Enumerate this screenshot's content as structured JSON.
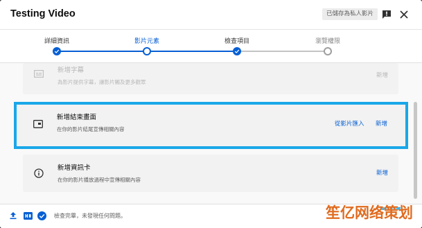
{
  "window": {
    "title": "Testing Video",
    "save_status": "已儲存為私人影片"
  },
  "icons": {
    "report": "report-flag-icon",
    "close": "close-icon"
  },
  "stepper": {
    "steps": [
      {
        "label": "詳細資訊",
        "state": "done"
      },
      {
        "label": "影片元素",
        "state": "current"
      },
      {
        "label": "檢查項目",
        "state": "done"
      },
      {
        "label": "瀏覽權限",
        "state": "future"
      }
    ]
  },
  "cards": [
    {
      "title": "新增字幕",
      "desc": "為影片提供字幕，讓影片觸及更多觀眾",
      "action": "新增",
      "secondary": "",
      "icon": "subtitles-icon"
    },
    {
      "title": "新增結束畫面",
      "desc": "在你的影片結尾宣傳相關內容",
      "action": "新增",
      "secondary": "從影片匯入",
      "icon": "end-screen-icon"
    },
    {
      "title": "新增資訊卡",
      "desc": "在你的影片播放過程中宣傳相關內容",
      "action": "新增",
      "secondary": "",
      "icon": "info-icon"
    }
  ],
  "footer": {
    "status": "檢查完畢，未發現任何問題。"
  },
  "watermark": {
    "text": "笙亿网络策划"
  },
  "colors": {
    "accent": "#065fd4",
    "highlight": "#1aa7e8",
    "watermark": "#e06b1f"
  }
}
